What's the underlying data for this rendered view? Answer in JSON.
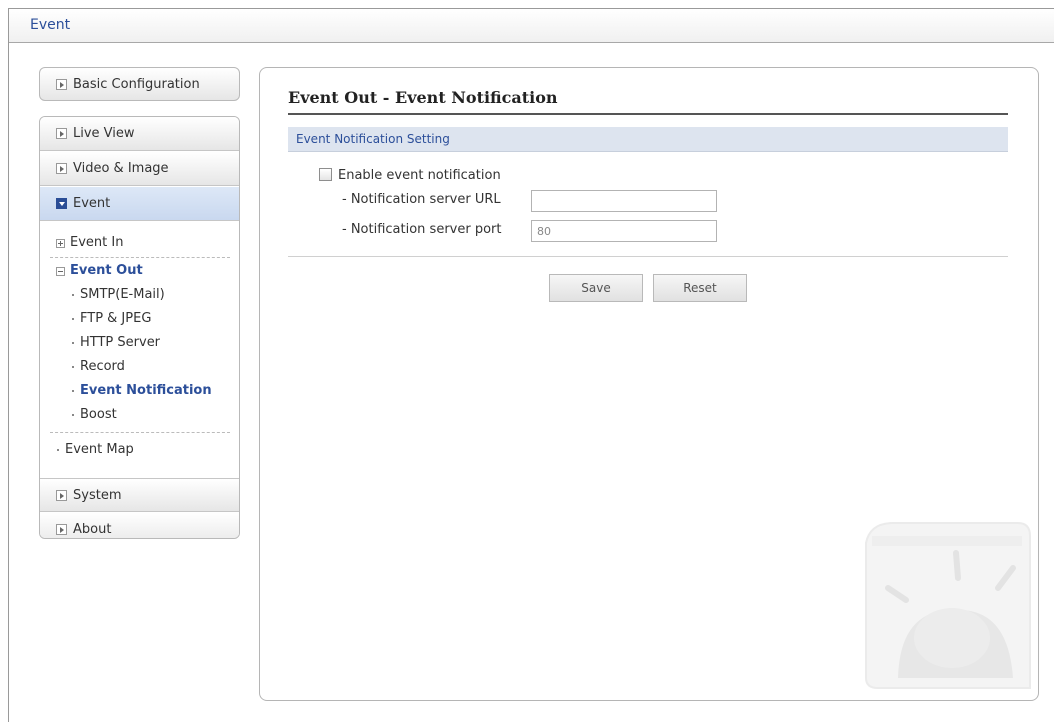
{
  "header": {
    "title": "Event"
  },
  "sidebar": {
    "basic": "Basic Configuration",
    "items": [
      {
        "label": "Live View"
      },
      {
        "label": "Video & Image"
      },
      {
        "label": "Event"
      }
    ],
    "event_sub": {
      "event_in": "Event In",
      "event_out": "Event Out",
      "children": [
        "SMTP(E-Mail)",
        "FTP & JPEG",
        "HTTP Server",
        "Record",
        "Event Notification",
        "Boost"
      ],
      "event_map": "Event Map"
    },
    "bottom": [
      {
        "label": "System"
      },
      {
        "label": "About"
      }
    ]
  },
  "main": {
    "title": "Event Out - Event Notification",
    "section": "Event Notification Setting",
    "enable_label": "Enable event notification",
    "enable_checked": false,
    "url_label": "- Notification server URL",
    "url_value": "",
    "port_label": "- Notification server port",
    "port_value": "80",
    "save": "Save",
    "reset": "Reset"
  },
  "colors": {
    "accent": "#2c4f9a",
    "section_bg": "#dde4ef",
    "active_bg": "#c9d8ef"
  }
}
